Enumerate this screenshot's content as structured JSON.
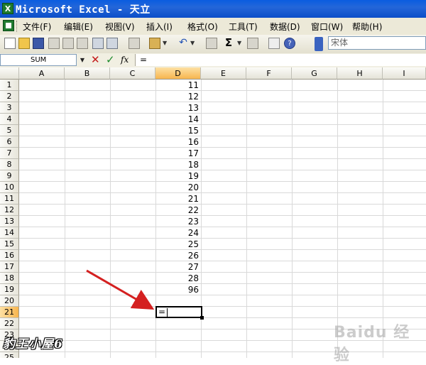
{
  "window": {
    "title": "Microsoft Excel - 天立",
    "app_icon": "excel-icon"
  },
  "menu": [
    "文件(F)",
    "编辑(E)",
    "视图(V)",
    "插入(I)",
    "格式(O)",
    "工具(T)",
    "数据(D)",
    "窗口(W)",
    "帮助(H)"
  ],
  "toolbar": {
    "font_name": "宋体"
  },
  "formula_bar": {
    "name_box": "SUM",
    "fx_label": "fx",
    "formula": "="
  },
  "columns": [
    "A",
    "B",
    "C",
    "D",
    "E",
    "F",
    "G",
    "H",
    "I"
  ],
  "selected_column": "D",
  "rows": [
    "1",
    "2",
    "3",
    "4",
    "5",
    "6",
    "7",
    "8",
    "9",
    "10",
    "11",
    "12",
    "13",
    "14",
    "15",
    "16",
    "17",
    "18",
    "19",
    "20",
    "21",
    "22",
    "23",
    "24",
    "25"
  ],
  "selected_row": "21",
  "column_d_values": [
    "11",
    "12",
    "13",
    "14",
    "15",
    "16",
    "17",
    "18",
    "19",
    "20",
    "21",
    "22",
    "23",
    "24",
    "25",
    "26",
    "27",
    "28",
    "96"
  ],
  "active_cell": {
    "address": "D21",
    "content": "="
  },
  "watermarks": {
    "left": "豹王小屋6",
    "right": "Baidu 经验"
  },
  "colors": {
    "title_bar": "#2466d9",
    "arrow": "#d42020",
    "selected_header": "#f7b54e"
  }
}
